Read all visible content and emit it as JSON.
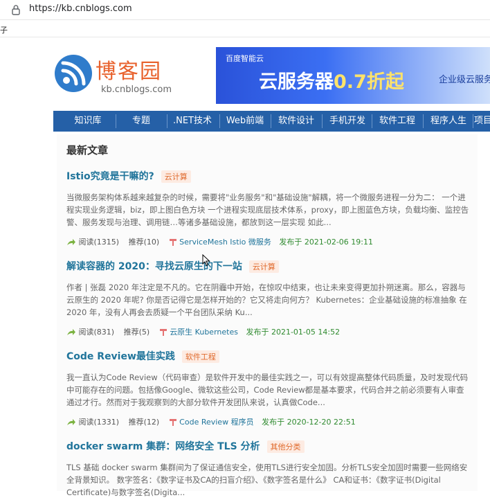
{
  "browser": {
    "url": "https://kb.cnblogs.com",
    "bookmark": "子"
  },
  "logo": {
    "name": "博客园",
    "domain": "kb.cnblogs.com"
  },
  "ad": {
    "brand": "百度智能云",
    "title": "云服务器",
    "discount": "0.7折起",
    "side": "企业级云服务"
  },
  "nav": {
    "items": [
      "知识库",
      "专题",
      ".NET技术",
      "Web前端",
      "软件设计",
      "手机开发",
      "软件工程",
      "程序人生",
      "项目"
    ]
  },
  "main": {
    "section_title": "最新文章",
    "articles": [
      {
        "title": "Istio究竟是干嘛的?",
        "tag": "云计算",
        "summary": "当微服务架构体系越来越复杂的时候，需要将\"业务服务\"和\"基础设施\"解耦，将一个微服务进程一分为二： 一个进程实现业务逻辑，biz，即上图白色方块 一个进程实现底层技术体系，proxy，即上图蓝色方块，负载均衡、监控告警、服务发现与治理、调用链…等诸多基础设施，都放到这一层实现 如此...",
        "reads": "阅读(1315)",
        "recommends": "推荐(10)",
        "tags_links": "ServiceMesh Istio 微服务",
        "published": "发布于 2021-02-06 19:11"
      },
      {
        "title": "解读容器的 2020：寻找云原生的下一站",
        "tag": "云计算",
        "summary": "作者 | 张磊 2020 年注定是不凡的。它在阴霾中开始，在惊叹中结束，也让未来变得更加扑朔迷离。那么，容器与云原生的 2020 年呢? 你是否记得它是怎样开始的？它又将走向何方？ Kubernetes：企业基础设施的标准抽象 在 2020 年，没有人再会去质疑一个平台团队采纳 Ku...",
        "reads": "阅读(831)",
        "recommends": "推荐(5)",
        "tags_links": "云原生 Kubernetes",
        "published": "发布于 2021-01-05 14:52"
      },
      {
        "title": "Code Review最佳实践",
        "tag": "软件工程",
        "summary": "我一直认为Code Review（代码审查）是软件开发中的最佳实践之一，可以有效提高整体代码质量，及时发现代码中可能存在的问题。包括像Google、微软这些公司，Code Review都是基本要求，代码合并之前必须要有人审查通过才行。然而对于我观察到的大部分软件开发团队来说，认真做Code...",
        "reads": "阅读(1331)",
        "recommends": "推荐(12)",
        "tags_links": "Code Review 程序员",
        "published": "发布于 2020-12-20 22:51"
      },
      {
        "title": "docker swarm 集群：网络安全 TLS 分析",
        "tag": "其他分类",
        "summary": "TLS 基础 docker swarm 集群间为了保证通信安全，使用TLS进行安全加固。分析TLS安全加固时需要一些网络安全背景知识。 数字签名：《数字证书及CA的扫盲介绍》、《数字签名是什么》 CA和证书：《数字证书(Digital Certificate)与数字签名(Digita...",
        "reads": "",
        "recommends": "",
        "tags_links": "",
        "published": ""
      }
    ]
  }
}
